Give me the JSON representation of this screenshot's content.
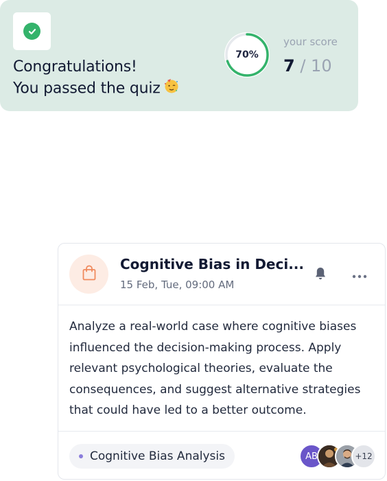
{
  "result": {
    "title_line1": "Congratulations!",
    "title_line2": "You passed the quiz",
    "emoji_icon": "partying-face-icon",
    "percent_label": "70%",
    "percent_value": 0.7,
    "score_label": "your score",
    "score_obtained": "7",
    "score_rest": " / 10",
    "colors": {
      "card_bg": "#dcebe5",
      "success": "#34b36b"
    }
  },
  "task": {
    "title": "Cognitive Bias in Deci...",
    "datetime": "15 Feb, Tue, 09:00 AM",
    "description": "Analyze a real-world case where cognitive biases influenced the decision-making process. Apply relevant psychological theories, evaluate the consequences, and suggest alternative strategies that could have led to a better outcome.",
    "tag": "Cognitive Bias Analysis",
    "tag_color": "#8b7ddb",
    "icon": "shopping-bag-icon",
    "icon_color": "#f08a5d",
    "participants": {
      "initials": "AB",
      "more": "+12"
    }
  }
}
